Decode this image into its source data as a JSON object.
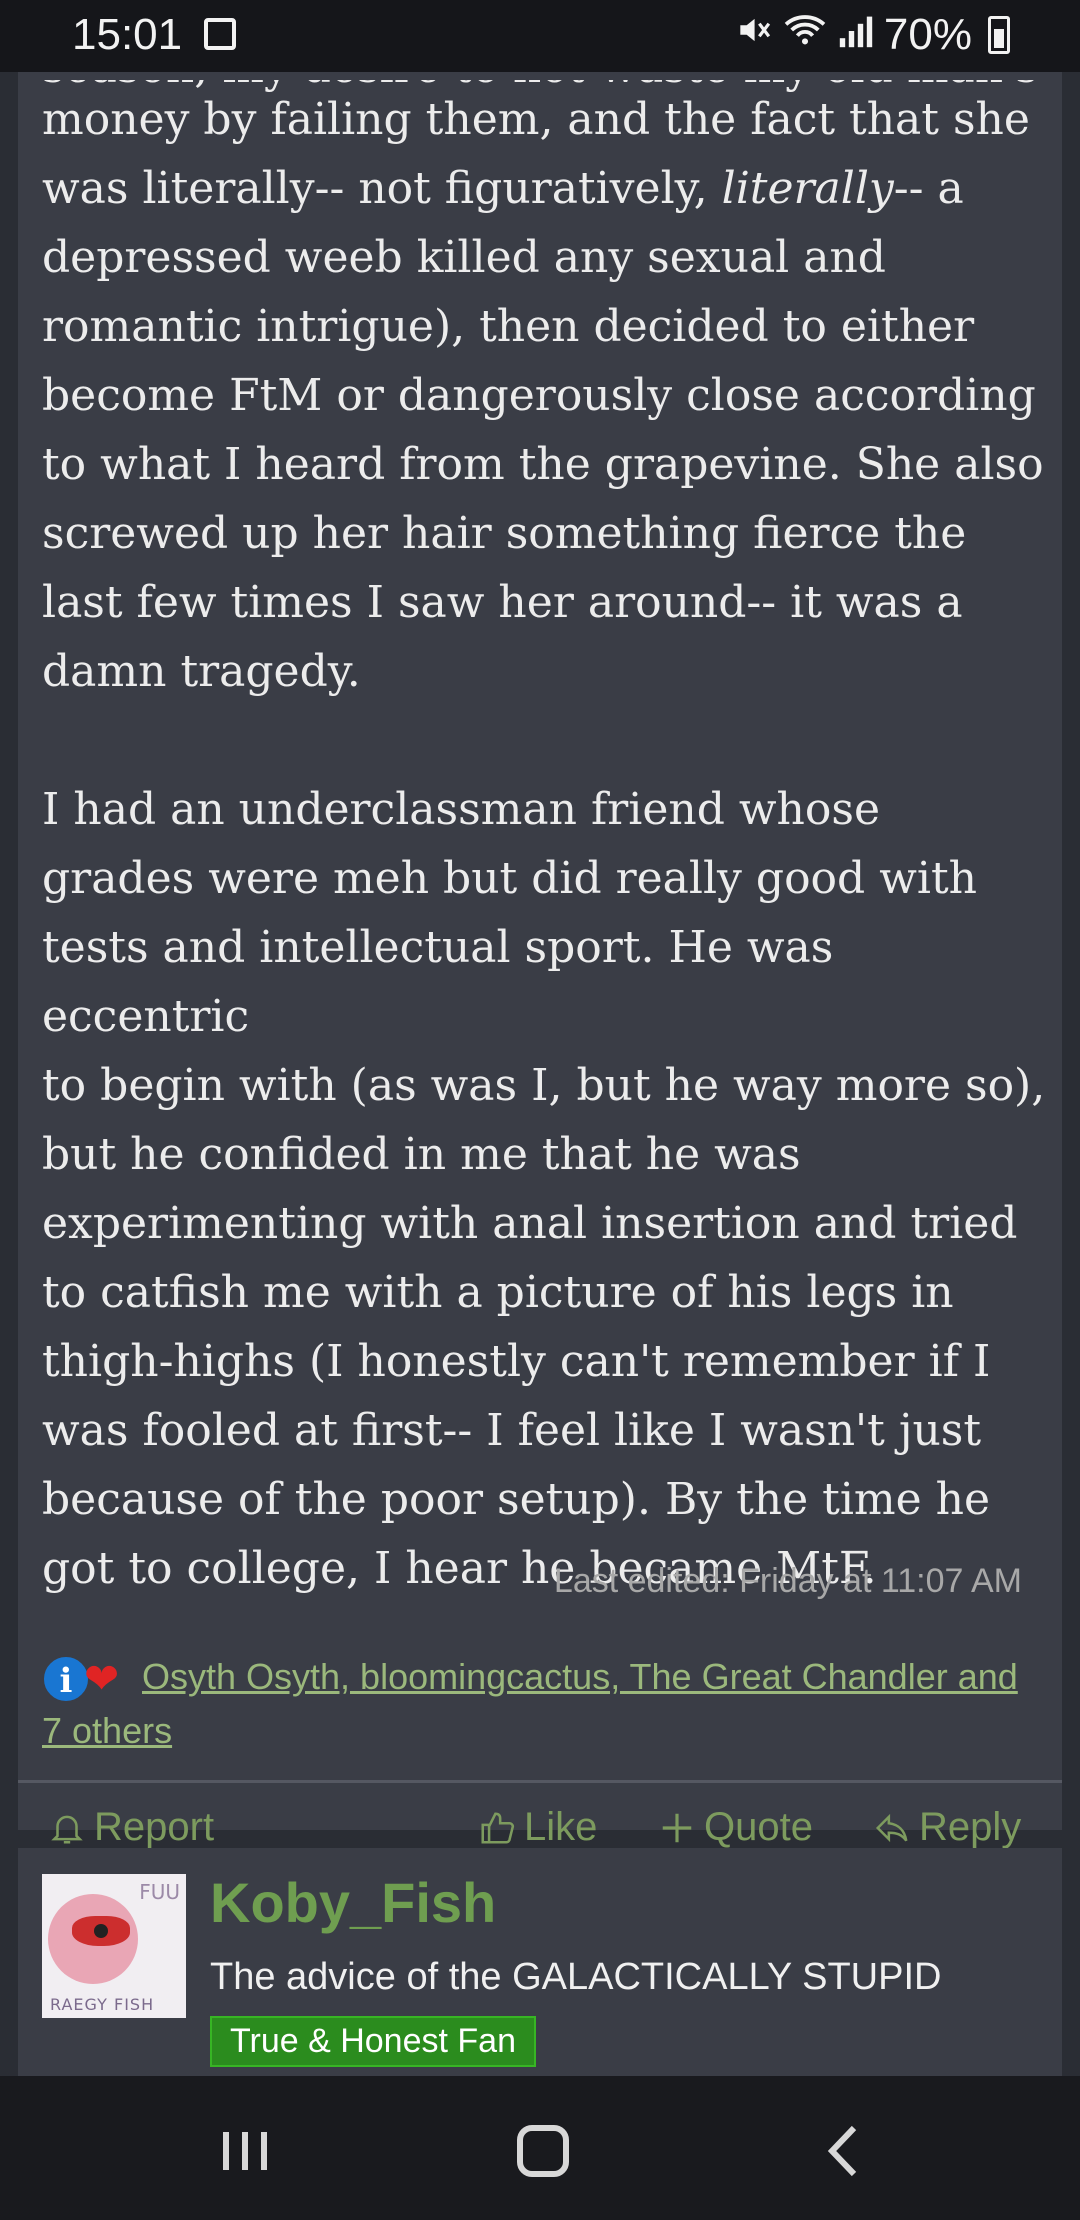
{
  "status_bar": {
    "time": "15:01",
    "battery": "70%",
    "icons": [
      "image-icon",
      "mute-icon",
      "wifi-icon",
      "signal-icon",
      "battery-icon"
    ]
  },
  "post": {
    "partial_top_line": "season, my desire to not waste my old man's",
    "paragraph_1": "money by failing them, and the fact that she\nwas literally-- not figuratively, ",
    "paragraph_1_italic": "literally",
    "paragraph_1_rest": "-- a\ndepressed weeb killed any sexual and\nromantic intrigue), then decided to either\nbecome FtM or dangerously close according\nto what I heard from the grapevine. She also\nscrewed up her hair something fierce the\nlast few times I saw her around-- it was a\ndamn tragedy.",
    "paragraph_2": "I had an underclassman friend whose\ngrades were meh but did really good with\ntests and intellectual sport. He was eccentric\nto begin with (as was I, but he way more so),\nbut he confided in me that he was\nexperimenting with anal insertion and tried\nto catfish me with a picture of his legs in\nthigh-highs (I honestly can't remember if I\nwas fooled at first-- I feel like I wasn't just\nbecause of the poor setup). By the time he\ngot to college, I hear he became MtF.",
    "last_edited": "Last edited: Friday at 11:07 AM",
    "reactions": {
      "info_glyph": "i",
      "heart_glyph": "❤",
      "users": "Osyth Osyth, bloomingcactus, The Great Chandler and 7 others"
    },
    "actions": {
      "report": "Report",
      "like": "Like",
      "quote": "Quote",
      "reply": "Reply"
    }
  },
  "next_post": {
    "username": "Koby_Fish",
    "user_title": "The advice of the GALACTICALLY STUPID",
    "badge": "True & Honest Fan",
    "avatar_caption": "RAEGY FISH",
    "avatar_text": "FUU"
  },
  "colors": {
    "background": "#2a2d34",
    "card": "#3a3d46",
    "accent_green": "#6f9e50",
    "badge_green": "#2b8c1e"
  }
}
